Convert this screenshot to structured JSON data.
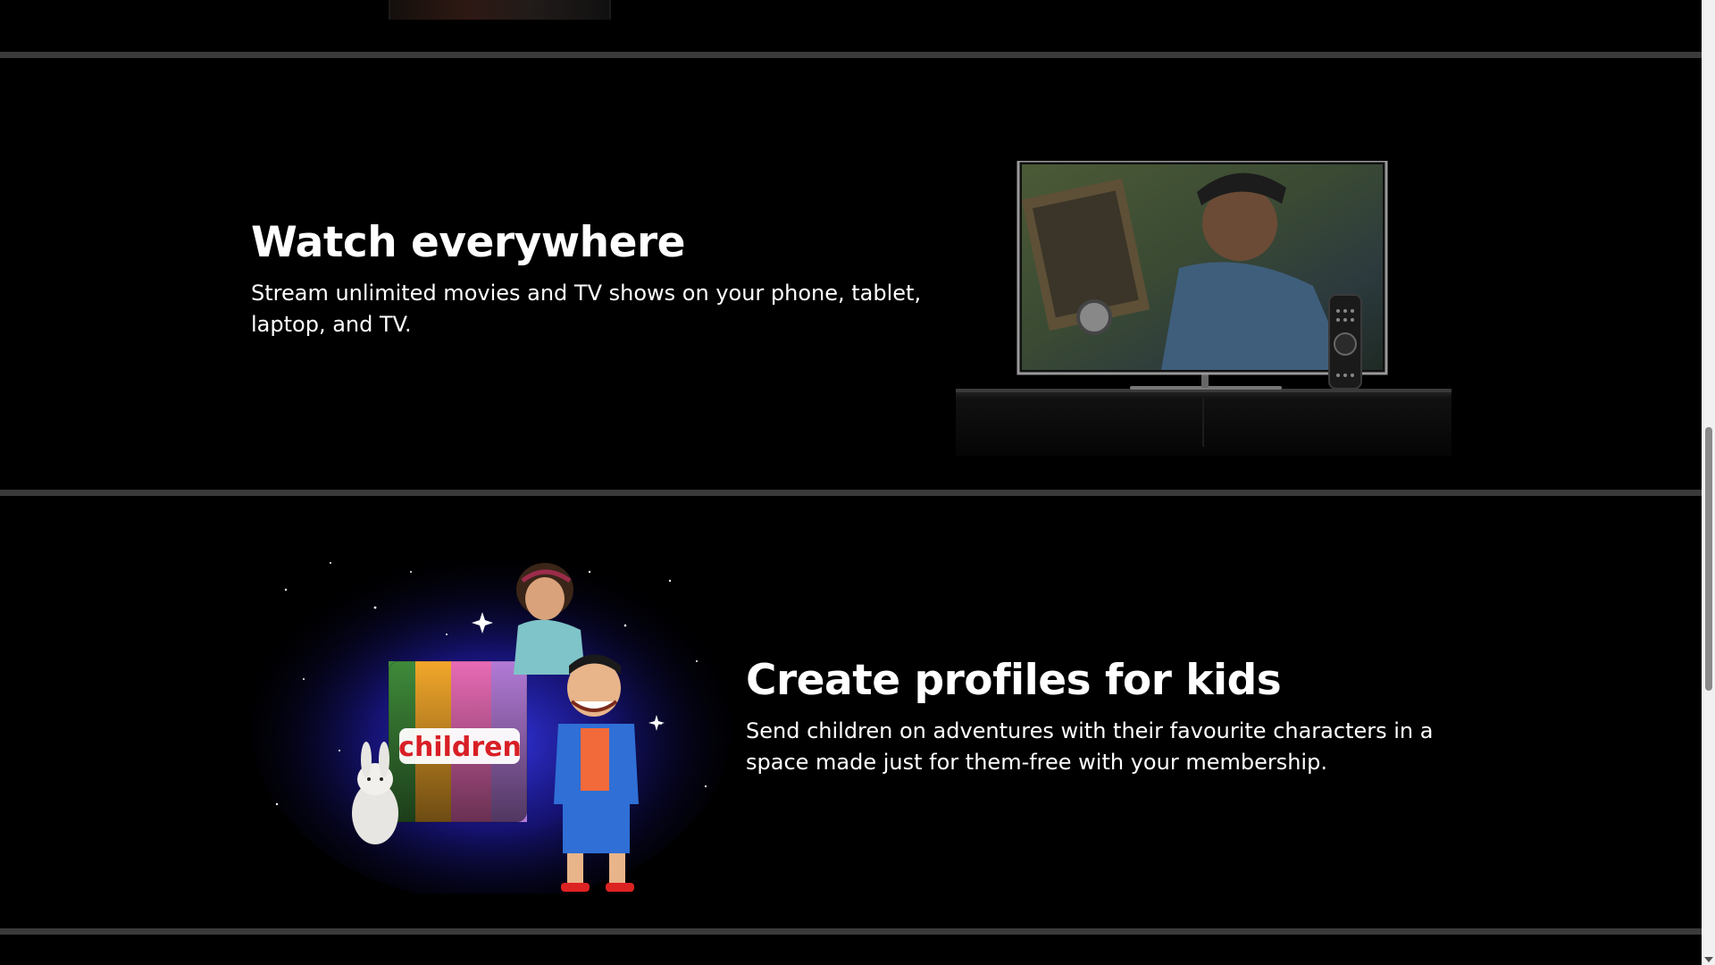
{
  "features": [
    {
      "title": "Watch everywhere",
      "description": "Stream unlimited movies and TV shows on your phone, tablet, laptop, and TV.",
      "image": "tv-with-remote-illustration"
    },
    {
      "title": "Create profiles for kids",
      "description": "Send children on adventures with their favourite characters in a space made just for them-free with your membership.",
      "image": "kids-characters-illustration",
      "image_text": "children"
    }
  ],
  "colors": {
    "background": "#000000",
    "divider": "#3a3a3a",
    "text": "#ffffff"
  }
}
